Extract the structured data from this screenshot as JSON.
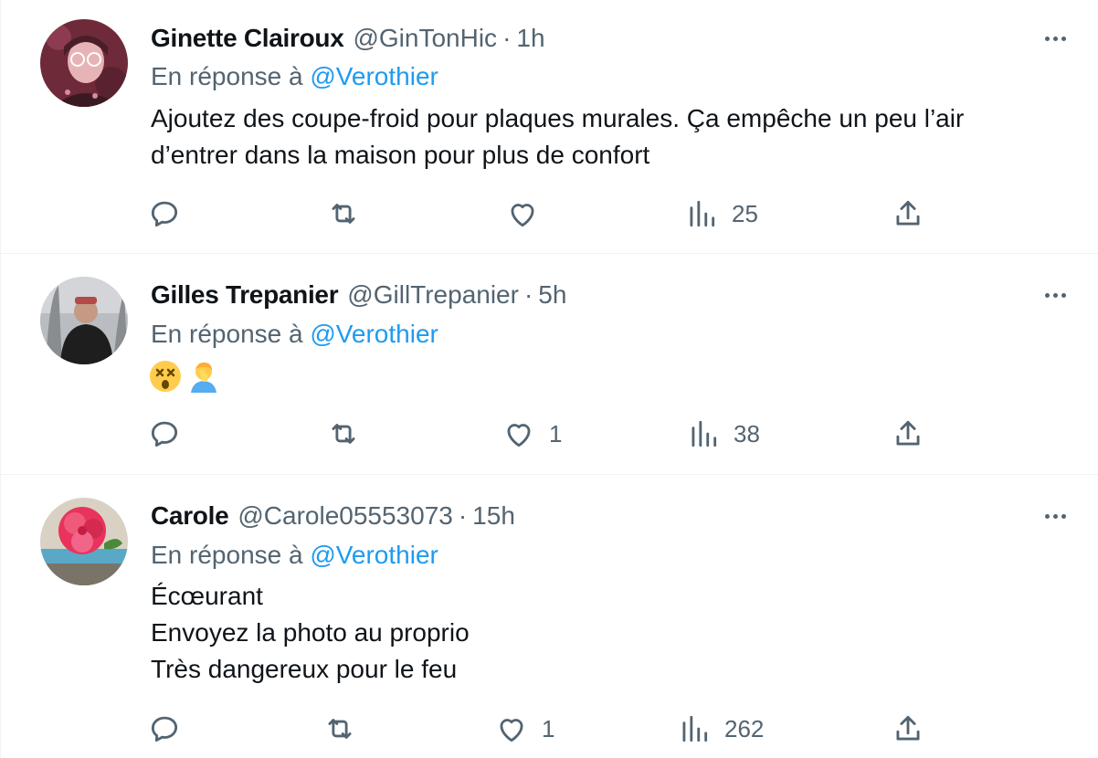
{
  "tweets": [
    {
      "name": "Ginette Clairoux",
      "handle": "@GinTonHic",
      "separator": "·",
      "time": "1h",
      "reply_prefix": "En réponse à",
      "reply_handle": "@Verothier",
      "lines": [
        "Ajoutez des coupe-froid pour plaques murales. Ça empêche un peu l’air",
        "d’entrer dans la maison pour plus de confort"
      ],
      "stats": {
        "replies": "",
        "retweets": "",
        "likes": "",
        "views": "25"
      }
    },
    {
      "name": "Gilles Trepanier",
      "handle": "@GillTrepanier",
      "separator": "·",
      "time": "5h",
      "reply_prefix": "En réponse à",
      "reply_handle": "@Verothier",
      "lines": [],
      "emojis": [
        "dizzy-face-emoji",
        "facepalm-emoji"
      ],
      "stats": {
        "replies": "",
        "retweets": "",
        "likes": "1",
        "views": "38"
      }
    },
    {
      "name": "Carole",
      "handle": "@Carole05553073",
      "separator": "·",
      "time": "15h",
      "reply_prefix": "En réponse à",
      "reply_handle": "@Verothier",
      "lines": [
        "Écœurant",
        "Envoyez la photo au proprio",
        "Très dangereux pour le feu"
      ],
      "stats": {
        "replies": "",
        "retweets": "",
        "likes": "1",
        "views": "262"
      }
    }
  ],
  "colors": {
    "text": "#0f1419",
    "secondary": "#536471",
    "link": "#1d9bf0",
    "divider": "#eff3f4"
  },
  "icons": [
    "reply-icon",
    "retweet-icon",
    "like-icon",
    "views-icon",
    "share-icon",
    "more-icon"
  ]
}
